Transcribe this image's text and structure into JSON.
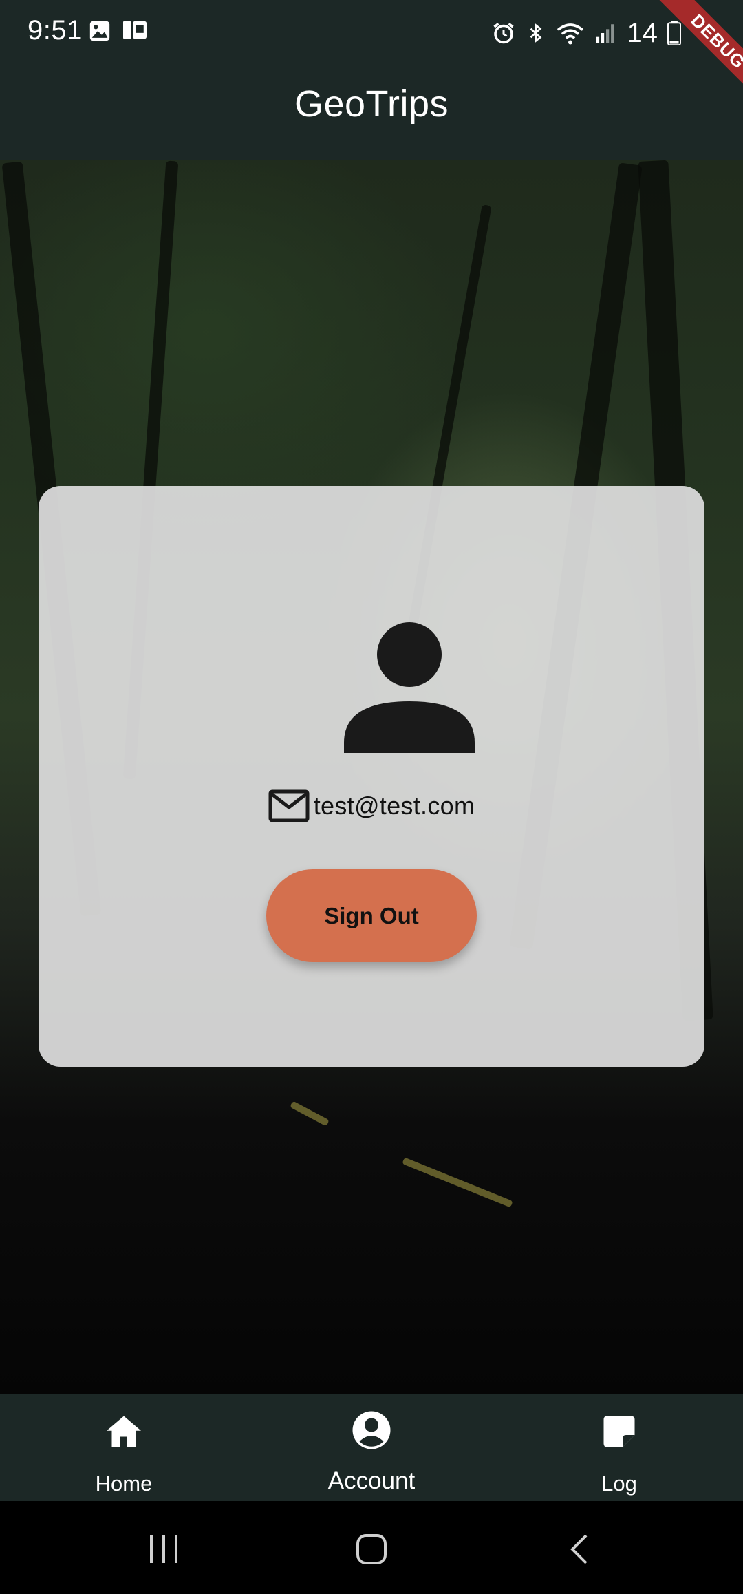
{
  "status_bar": {
    "time": "9:51",
    "battery": "14"
  },
  "debug_banner": "DEBUG",
  "app_bar": {
    "title": "GeoTrips"
  },
  "profile": {
    "avatar_icon": "person-icon",
    "email_icon": "mail-icon",
    "email": "test@test.com",
    "sign_out_label": "Sign Out"
  },
  "bottom_nav": {
    "items": [
      {
        "label": "Home",
        "icon": "home-icon"
      },
      {
        "label": "Account",
        "icon": "account-circle-icon",
        "selected": true
      },
      {
        "label": "Log",
        "icon": "note-icon"
      }
    ]
  },
  "system_nav": {
    "buttons": [
      "recents-icon",
      "home-circle-icon",
      "back-icon"
    ]
  },
  "colors": {
    "app_bar": "#1c2826",
    "accent_button": "#d4704e",
    "card": "#dedede",
    "debug_ribbon": "#a52a2a"
  }
}
